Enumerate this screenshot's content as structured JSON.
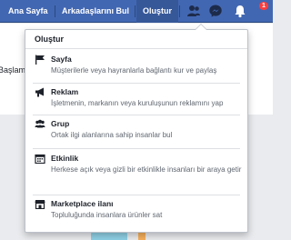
{
  "topbar": {
    "home_label": "Ana Sayfa",
    "find_friends_label": "Arkadaşlarını Bul",
    "create_label": "Oluştur",
    "notifications_count": "1"
  },
  "background": {
    "partial_text": "Başlam"
  },
  "create_menu": {
    "header": "Oluştur",
    "items": [
      {
        "title": "Sayfa",
        "description": "Müşterilerle veya hayranlarla bağlantı kur ve paylaş",
        "icon": "flag-icon"
      },
      {
        "title": "Reklam",
        "description": "İşletmenin, markanın veya kuruluşunun reklamını yap",
        "icon": "megaphone-icon"
      },
      {
        "title": "Grup",
        "description": "Ortak ilgi alanlarına sahip insanlar bul",
        "icon": "group-icon"
      },
      {
        "title": "Etkinlik",
        "description": "Herkese açık veya gizli bir etkinlikle insanları bir araya getir",
        "icon": "calendar-icon"
      },
      {
        "title": "Marketplace ilanı",
        "description": "Topluluğunda insanlara ürünler sat",
        "icon": "shop-icon"
      }
    ]
  },
  "colors": {
    "brand_blue": "#4267b2",
    "active_blue": "#365899",
    "notification_red": "#fa3e3e"
  }
}
